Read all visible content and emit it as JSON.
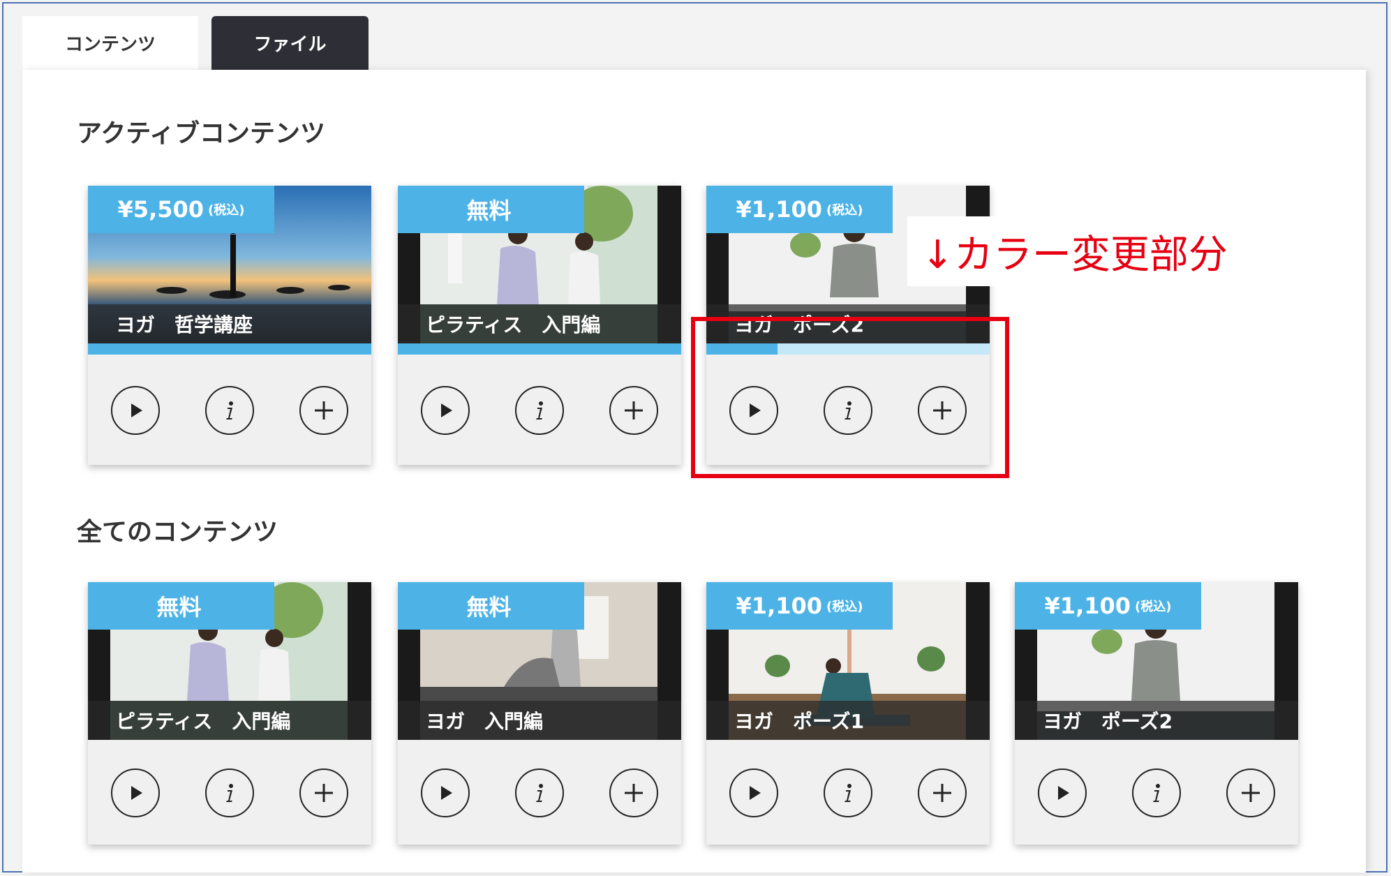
{
  "tabs": [
    {
      "label": "コンテンツ"
    },
    {
      "label": "ファイル"
    }
  ],
  "sections": {
    "active_title": "アクティブコンテンツ",
    "all_title": "全てのコンテンツ"
  },
  "active_cards": [
    {
      "price": "¥5,500",
      "tax": "(税込)",
      "title": "ヨガ　哲学講座",
      "progress": 1.0
    },
    {
      "price": "無料",
      "tax": "",
      "title": "ピラティス　入門編",
      "progress": 1.0
    },
    {
      "price": "¥1,100",
      "tax": "(税込)",
      "title": "ヨガ　ポーズ2",
      "progress": 0.25
    }
  ],
  "all_cards": [
    {
      "price": "無料",
      "tax": "",
      "title": "ピラティス　入門編"
    },
    {
      "price": "無料",
      "tax": "",
      "title": "ヨガ　入門編"
    },
    {
      "price": "¥1,100",
      "tax": "(税込)",
      "title": "ヨガ　ポーズ1"
    },
    {
      "price": "¥1,100",
      "tax": "(税込)",
      "title": "ヨガ　ポーズ2"
    }
  ],
  "card_actions": [
    "play-icon",
    "info-icon",
    "plus-icon"
  ],
  "annotation": {
    "text": "↓カラー変更部分",
    "color": "#e60012"
  },
  "colors": {
    "accent": "#4db3e6",
    "accent_light": "#c4e8f7",
    "tab_dark": "#2e2f36"
  }
}
